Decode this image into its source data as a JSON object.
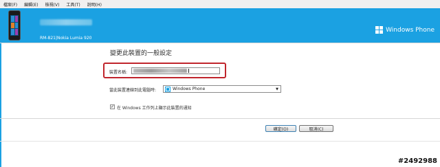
{
  "menu": [
    {
      "label": "檔案(F)"
    },
    {
      "label": "編輯(E)"
    },
    {
      "label": "檢視(V)"
    },
    {
      "label": "工具(T)"
    },
    {
      "label": "說明(H)"
    }
  ],
  "header": {
    "device_model": "RM-821|Nokia Lumia 920",
    "brand_logo_text": "Windows Phone",
    "background_color": "#1ba1e2"
  },
  "settings": {
    "title": "變更此裝置的一般設定",
    "device_name_label": "裝置名稱:",
    "sync_label": "當此裝置連線到此電腦時:",
    "sync_selected": "Windows Phone",
    "notify_label": "在 Windows 工作列上顯示此裝置的通知",
    "notify_checked": true,
    "highlight_color": "#c0242b"
  },
  "buttons": {
    "ok_label": "確定(O)",
    "cancel_label": "取消(C)"
  },
  "watermark": "#2492988",
  "icons": {
    "phone": "phone-image-icon",
    "windows": "windows-flag-icon",
    "select_item": "windows-phone-icon",
    "dropdown": "chevron-down-icon",
    "checkbox": "checkmark-icon"
  }
}
